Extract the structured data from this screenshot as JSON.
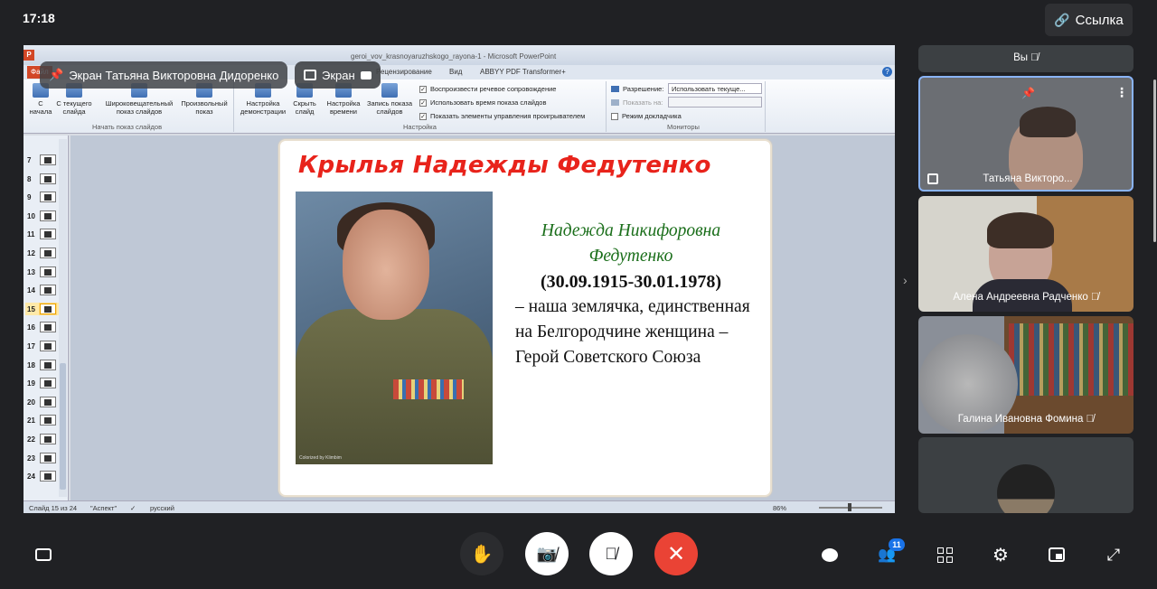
{
  "status": {
    "time": "17:18"
  },
  "header": {
    "link_label": "Ссылка"
  },
  "share": {
    "presenter_label": "Экран Татьяна Викторовна Дидоренко",
    "screen_label": "Экран"
  },
  "ppt": {
    "window_title": "geroi_vov_krasnoyaruzhskogo_rayona-1 - Microsoft PowerPoint",
    "tabs": [
      "Файл",
      "Рецензирование",
      "Вид",
      "ABBYY PDF Transformer+"
    ],
    "ribbon": {
      "btn_from_start": "С начала",
      "btn_from_current": "С текущего слайда",
      "btn_widescreen": "Широковещательный показ слайдов",
      "btn_custom": "Произвольный показ",
      "btn_setup": "Настройка демонстрации",
      "btn_hide": "Скрыть слайд",
      "btn_timing": "Настройка времени",
      "btn_record": "Запись показа слайдов",
      "group_start": "Начать показ слайдов",
      "group_setup": "Настройка",
      "group_monitors": "Мониторы",
      "chk_narration": "Воспроизвести речевое сопровождение",
      "chk_timings": "Использовать время показа слайдов",
      "chk_controls": "Показать элементы управления проигрывателем",
      "resolution_label": "Разрешение:",
      "resolution_value": "Использовать текуще...",
      "show_on_label": "Показать на:",
      "presenter_view": "Режим докладчика"
    },
    "thumbnails": [
      "7",
      "8",
      "9",
      "10",
      "11",
      "12",
      "13",
      "14",
      "15",
      "16",
      "17",
      "18",
      "19",
      "20",
      "21",
      "22",
      "23",
      "24"
    ],
    "selected_slide": "15",
    "slide": {
      "title": "Крылья Надежды Федутенко",
      "name": "Надежда Никифоровна Федутенко",
      "dates": "(30.09.1915-30.01.1978)",
      "text": "– наша землячка, единственная на Белгородчине женщина – Герой Советского Союза",
      "photo_caption": "Colorized by Klimbim"
    },
    "statusbar": {
      "slide_pos": "Слайд 15 из 24",
      "theme": "\"Аспект\"",
      "language": "русский",
      "zoom": "86%"
    }
  },
  "participants": [
    {
      "name": "Вы"
    },
    {
      "name": "Татьяна Викторо..."
    },
    {
      "name": "Алена Андреевна Радченко"
    },
    {
      "name": "Галина Ивановна Фомина"
    }
  ],
  "controls": {
    "participants_count": "11"
  }
}
